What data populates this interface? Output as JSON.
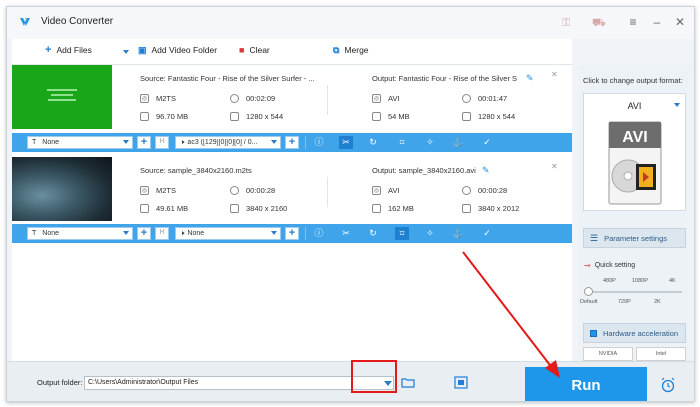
{
  "window": {
    "title": "Video Converter"
  },
  "toolbar": {
    "add_files": "Add Files",
    "add_video_folder": "Add Video Folder",
    "clear": "Clear",
    "merge": "Merge"
  },
  "files": [
    {
      "source": "Source: Fantastic Four - Rise of the Silver Surfer - ...",
      "output": "Output: Fantastic Four - Rise of the Silver S",
      "src_format": "M2TS",
      "src_duration": "00:02:09",
      "src_size": "96.70 MB",
      "src_resolution": "1280 x 544",
      "out_format": "AVI",
      "out_duration": "00:01:47",
      "out_size": "54 MB",
      "out_resolution": "1280 x 544",
      "subtitle": "None",
      "audio": "ac3 ([129][0][0][0] / 0..."
    },
    {
      "source": "Source: sample_3840x2160.m2ts",
      "output": "Output: sample_3840x2160.avi",
      "src_format": "M2TS",
      "src_duration": "00:00:28",
      "src_size": "49.61 MB",
      "src_resolution": "3840 x 2160",
      "out_format": "AVI",
      "out_duration": "00:00:28",
      "out_size": "162 MB",
      "out_resolution": "3840 x 2012",
      "subtitle": "None",
      "audio": "None"
    }
  ],
  "right_panel": {
    "click_label": "Click to change output format:",
    "format": "AVI",
    "format_image_text": "AVI",
    "parameter_settings": "Parameter settings",
    "quick_setting": "Quick setting",
    "ticks_top": [
      "480P",
      "1080P",
      "4K"
    ],
    "ticks_bottom": [
      "Default",
      "720P",
      "2K"
    ],
    "quality_level": 0,
    "hardware_acceleration": "Hardware acceleration",
    "nvidia": "NVIDIA",
    "intel": "Intel"
  },
  "bottom": {
    "output_folder_label": "Output folder:",
    "output_folder_value": "C:\\Users\\Administrator\\Output Files",
    "run": "Run"
  },
  "colors": {
    "accent": "#1e96ea",
    "option_bar": "#3fa4e9",
    "annotation": "#e21a1a"
  }
}
